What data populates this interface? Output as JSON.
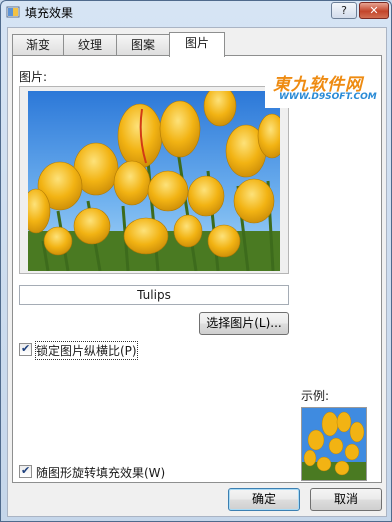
{
  "window": {
    "title": "填充效果",
    "help_glyph": "?",
    "close_glyph": "✕"
  },
  "tabs": [
    {
      "label": "渐变",
      "active": false
    },
    {
      "label": "纹理",
      "active": false
    },
    {
      "label": "图案",
      "active": false
    },
    {
      "label": "图片",
      "active": true
    }
  ],
  "picture_panel": {
    "picture_label": "图片:",
    "picture_name": "Tulips",
    "select_picture_button": "选择图片(L)...",
    "lock_aspect_checkbox": {
      "label": "锁定图片纵横比(P)",
      "checked": true
    },
    "rotate_with_shape_checkbox": {
      "label": "随图形旋转填充效果(W)",
      "checked": true
    },
    "sample_label": "示例:"
  },
  "footer": {
    "ok_button": "确定",
    "cancel_button": "取消"
  },
  "watermark": {
    "brand": "東九软件网",
    "url": "WWW.D9SOFT.COM"
  },
  "colors": {
    "sky": "#3f8be0",
    "tulip": "#f2b313",
    "stem": "#3d6b1c"
  },
  "icons": {
    "title_icon": "fill-effect-icon",
    "check": "checkmark-icon"
  }
}
